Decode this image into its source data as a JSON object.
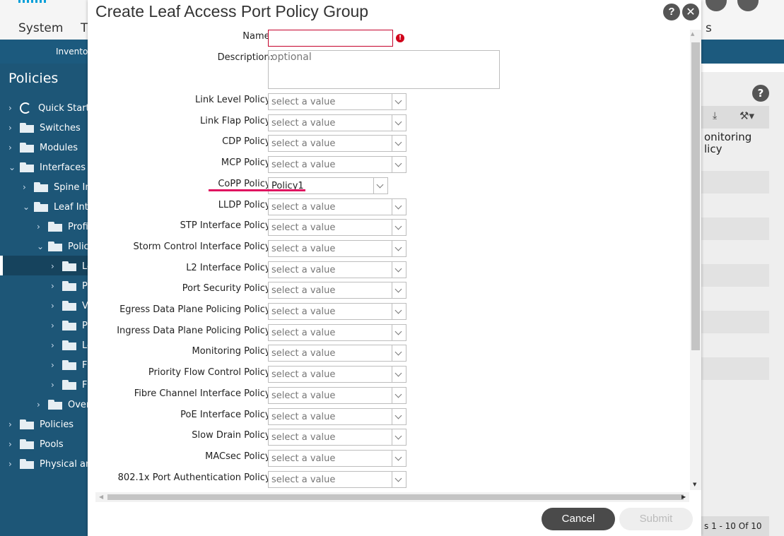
{
  "app": {
    "top_tabs": [
      "System",
      "T"
    ],
    "nav_label": "Invento",
    "sidebar_title": "Policies",
    "tree": [
      {
        "label": "Quick Start",
        "icon": "quick-start-icon",
        "level": 0,
        "chev": "›"
      },
      {
        "label": "Switches",
        "icon": "folder-icon",
        "level": 0,
        "chev": "›"
      },
      {
        "label": "Modules",
        "icon": "folder-icon",
        "level": 0,
        "chev": "›"
      },
      {
        "label": "Interfaces",
        "icon": "folder-icon",
        "level": 0,
        "chev": "⌄"
      },
      {
        "label": "Spine Int",
        "icon": "folder-icon",
        "level": 1,
        "chev": "›"
      },
      {
        "label": "Leaf Inte",
        "icon": "folder-icon",
        "level": 1,
        "chev": "⌄"
      },
      {
        "label": "Profil",
        "icon": "folder-icon",
        "level": 2,
        "chev": "›"
      },
      {
        "label": "Polic",
        "icon": "folder-icon",
        "level": 2,
        "chev": "⌄"
      },
      {
        "label": "Le",
        "icon": "folder-icon",
        "level": 3,
        "chev": "›"
      },
      {
        "label": "Po",
        "icon": "folder-icon",
        "level": 3,
        "chev": "›"
      },
      {
        "label": "VI",
        "icon": "folder-icon",
        "level": 3,
        "chev": "›"
      },
      {
        "label": "Po",
        "icon": "folder-icon",
        "level": 3,
        "chev": "›"
      },
      {
        "label": "Le",
        "icon": "folder-icon",
        "level": 3,
        "chev": "›"
      },
      {
        "label": "FC",
        "icon": "folder-icon",
        "level": 3,
        "chev": "›"
      },
      {
        "label": "FC",
        "icon": "folder-icon",
        "level": 3,
        "chev": "›"
      },
      {
        "label": "Over",
        "icon": "folder-icon",
        "level": 2,
        "chev": "›"
      },
      {
        "label": "Policies",
        "icon": "folder-icon",
        "level": 0,
        "chev": "›"
      },
      {
        "label": "Pools",
        "icon": "folder-icon",
        "level": 0,
        "chev": "›"
      },
      {
        "label": "Physical and",
        "icon": "folder-icon",
        "level": 0,
        "chev": "›"
      }
    ],
    "right_panel": {
      "help": "?",
      "text1": "onitoring",
      "text2": "licy",
      "pages": "s 1 - 10 Of 10",
      "partial_s": "s"
    }
  },
  "dialog": {
    "title": "Create Leaf Access Port Policy Group",
    "help": "?",
    "close": "✕",
    "name_label": "Name:",
    "name_value": "",
    "name_error": "!",
    "description_label": "Description:",
    "description_placeholder": "optional",
    "fields": [
      {
        "label": "Link Level Policy:",
        "value": "select a value"
      },
      {
        "label": "Link Flap Policy:",
        "value": "select a value"
      },
      {
        "label": "CDP Policy:",
        "value": "select a value"
      },
      {
        "label": "MCP Policy:",
        "value": "select a value"
      },
      {
        "label": "CoPP Policy:",
        "value": "Policy1"
      },
      {
        "label": "LLDP Policy:",
        "value": "select a value"
      },
      {
        "label": "STP Interface Policy:",
        "value": "select a value"
      },
      {
        "label": "Storm Control Interface Policy:",
        "value": "select a value"
      },
      {
        "label": "L2 Interface Policy:",
        "value": "select a value"
      },
      {
        "label": "Port Security Policy:",
        "value": "select a value"
      },
      {
        "label": "Egress Data Plane Policing Policy:",
        "value": "select a value"
      },
      {
        "label": "Ingress Data Plane Policing Policy:",
        "value": "select a value"
      },
      {
        "label": "Monitoring Policy:",
        "value": "select a value"
      },
      {
        "label": "Priority Flow Control Policy:",
        "value": "select a value"
      },
      {
        "label": "Fibre Channel Interface Policy:",
        "value": "select a value"
      },
      {
        "label": "PoE Interface Policy:",
        "value": "select a value"
      },
      {
        "label": "Slow Drain Policy:",
        "value": "select a value"
      },
      {
        "label": "MACsec Policy:",
        "value": "select a value"
      },
      {
        "label": "802.1x Port Authentication Policy:",
        "value": "select a value"
      }
    ],
    "cancel": "Cancel",
    "submit": "Submit"
  },
  "colors": {
    "sidebar": "#1d5677",
    "accent_underline": "#e0115f",
    "error": "#d0021b"
  }
}
